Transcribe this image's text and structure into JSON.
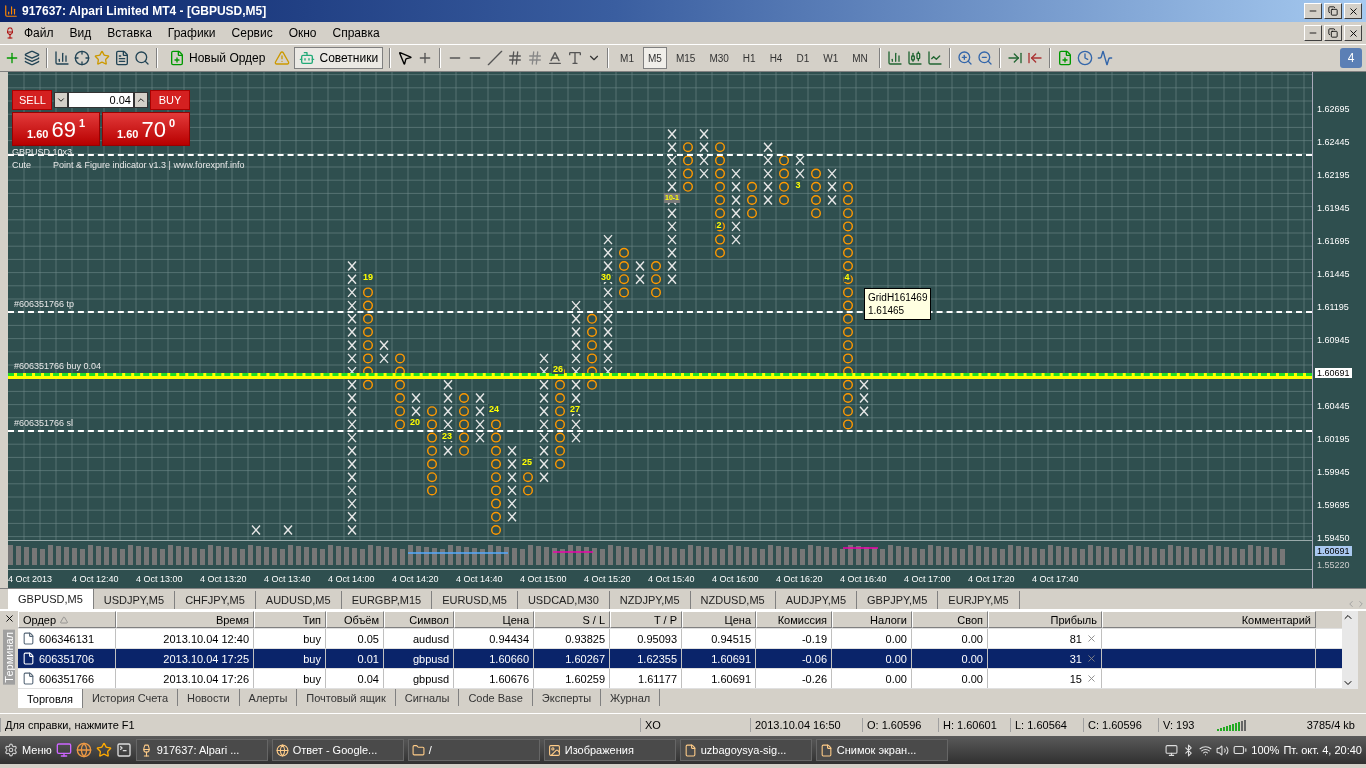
{
  "window": {
    "title": "917637: Alpari Limited MT4 - [GBPUSD,M5]"
  },
  "menu": [
    "Файл",
    "Вид",
    "Вставка",
    "Графики",
    "Сервис",
    "Окно",
    "Справка"
  ],
  "toolbar": {
    "new_order": "Новый Ордер",
    "experts": {
      "label": "Советники",
      "on": true
    },
    "timeframes": [
      {
        "label": "M1",
        "selected": false
      },
      {
        "label": "M5",
        "selected": true
      },
      {
        "label": "M15",
        "selected": false
      },
      {
        "label": "M30",
        "selected": false
      },
      {
        "label": "H1",
        "selected": false
      },
      {
        "label": "H4",
        "selected": false
      },
      {
        "label": "D1",
        "selected": false
      },
      {
        "label": "W1",
        "selected": false
      },
      {
        "label": "MN",
        "selected": false
      }
    ],
    "notifications": "4"
  },
  "trade_panel": {
    "sell": "SELL",
    "buy": "BUY",
    "volume": "0.04",
    "bid": {
      "base": "1.60",
      "pips": "69",
      "fraction": "1"
    },
    "ask": {
      "base": "1.60",
      "pips": "70",
      "fraction": "0"
    }
  },
  "chart": {
    "symbol_line": "GBPUSD 10x3",
    "indicator_name": "Cute",
    "indicator_info": "Point & Figure indicator v1.3 | www.forexpnf.info",
    "box_labels": [
      "19",
      "20",
      "23",
      "24",
      "25",
      "26",
      "27",
      "30",
      "10-1",
      "2",
      "3",
      "4"
    ],
    "order_lines": [
      {
        "kind": "level"
      },
      {
        "kind": "level",
        "label": "#606351766 tp"
      },
      {
        "kind": "entry",
        "label": "#606351766 buy 0.04"
      },
      {
        "kind": "level",
        "label": "#606351766 sl"
      }
    ],
    "tooltip": {
      "title": "GridH161469",
      "value": "1.61465"
    },
    "price_axis": [
      "1.62695",
      "1.62445",
      "1.62195",
      "1.61945",
      "1.61695",
      "1.61445",
      "1.61195",
      "1.60945",
      "1.60445",
      "1.60195",
      "1.59945",
      "1.59695",
      "1.59450"
    ],
    "current_price": "1.60691",
    "sub_axis": [
      "1.60691",
      "1.55220"
    ],
    "time_axis": [
      "4 Oct 2013",
      "4 Oct 12:40",
      "4 Oct 13:00",
      "4 Oct 13:20",
      "4 Oct 13:40",
      "4 Oct 14:00",
      "4 Oct 14:20",
      "4 Oct 14:40",
      "4 Oct 15:00",
      "4 Oct 15:20",
      "4 Oct 15:40",
      "4 Oct 16:00",
      "4 Oct 16:20",
      "4 Oct 16:40",
      "4 Oct 17:00",
      "4 Oct 17:20",
      "4 Oct 17:40"
    ]
  },
  "chart_tabs": [
    {
      "label": "GBPUSD,M5",
      "selected": true
    },
    {
      "label": "USDJPY,M5",
      "selected": false
    },
    {
      "label": "CHFJPY,M5",
      "selected": false
    },
    {
      "label": "AUDUSD,M5",
      "selected": false
    },
    {
      "label": "EURGBP,M15",
      "selected": false
    },
    {
      "label": "EURUSD,M5",
      "selected": false
    },
    {
      "label": "USDCAD,M30",
      "selected": false
    },
    {
      "label": "NZDJPY,M5",
      "selected": false
    },
    {
      "label": "NZDUSD,M5",
      "selected": false
    },
    {
      "label": "AUDJPY,M5",
      "selected": false
    },
    {
      "label": "GBPJPY,M5",
      "selected": false
    },
    {
      "label": "EURJPY,M5",
      "selected": false
    }
  ],
  "terminal": {
    "title": "Терминал",
    "columns": [
      "Ордер",
      "Время",
      "Тип",
      "Объём",
      "Символ",
      "Цена",
      "S / L",
      "T / P",
      "Цена",
      "Комиссия",
      "Налоги",
      "Своп",
      "Прибыль",
      "Комментарий"
    ],
    "rows": [
      {
        "selected": false,
        "cells": [
          "606346131",
          "2013.10.04 12:40",
          "buy",
          "0.05",
          "audusd",
          "0.94434",
          "0.93825",
          "0.95093",
          "0.94515",
          "-0.19",
          "0.00",
          "0.00",
          "81"
        ]
      },
      {
        "selected": true,
        "cells": [
          "606351706",
          "2013.10.04 17:25",
          "buy",
          "0.01",
          "gbpusd",
          "1.60660",
          "1.60267",
          "1.62355",
          "1.60691",
          "-0.06",
          "0.00",
          "0.00",
          "31"
        ]
      },
      {
        "selected": false,
        "cells": [
          "606351766",
          "2013.10.04 17:26",
          "buy",
          "0.04",
          "gbpusd",
          "1.60676",
          "1.60259",
          "1.61177",
          "1.60691",
          "-0.26",
          "0.00",
          "0.00",
          "15"
        ]
      }
    ],
    "tabs": [
      {
        "label": "Торговля",
        "selected": true
      },
      {
        "label": "История Счета",
        "selected": false
      },
      {
        "label": "Новости",
        "selected": false
      },
      {
        "label": "Алерты",
        "selected": false
      },
      {
        "label": "Почтовый ящик",
        "selected": false
      },
      {
        "label": "Сигналы",
        "selected": false
      },
      {
        "label": "Code Base",
        "selected": false
      },
      {
        "label": "Эксперты",
        "selected": false
      },
      {
        "label": "Журнал",
        "selected": false
      }
    ]
  },
  "status_bar": [
    "Для справки, нажмите F1",
    "XO",
    "2013.10.04 16:50",
    "O: 1.60596",
    "H: 1.60601",
    "L: 1.60564",
    "C: 1.60596",
    "V: 193",
    "3785/4 kb"
  ],
  "taskbar": {
    "menu": "Меню",
    "tasks": [
      "917637: Alpari ...",
      "Ответ - Google...",
      "/",
      "Изображения",
      "uzbagoysya-sig...",
      "Снимок экран..."
    ],
    "battery": "100%",
    "clock": "Пт. окт.  4, 20:40"
  }
}
